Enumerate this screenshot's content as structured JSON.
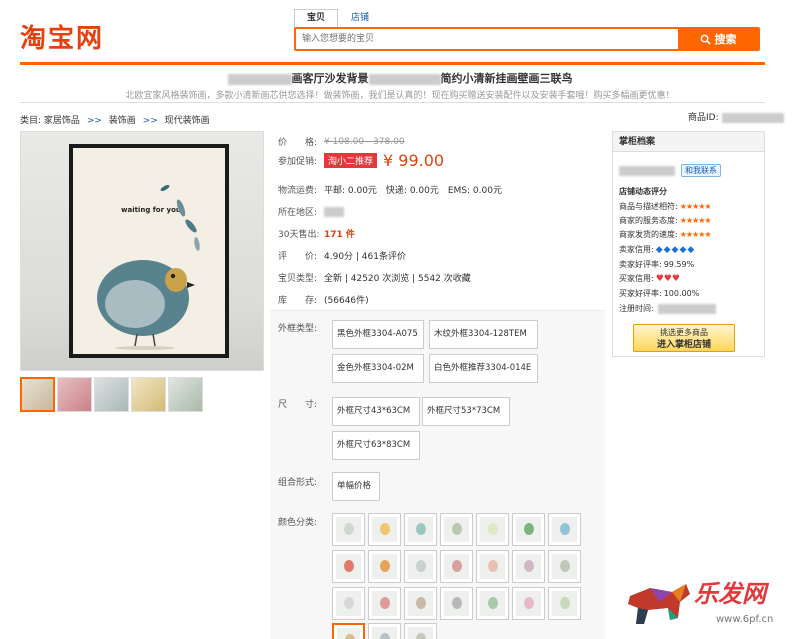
{
  "header": {
    "logo": "淘宝网",
    "tabs": [
      {
        "label": "宝贝"
      },
      {
        "label": "店铺"
      }
    ],
    "search_placeholder": "输入您想要的宝贝",
    "search_button": "搜索"
  },
  "title": {
    "part1": "画客厅沙发背景",
    "part2": "简约小清新挂画壁画三联鸟",
    "subtitle": "北欧宜家风格装饰画，多款小清新画芯供您选择！做装饰画，我们是认真的！现在购买赠送安装配件以及安装手套哦！购买多幅画更优惠！"
  },
  "breadcrumb": {
    "prefix": "类目:",
    "items": [
      "家居饰品",
      "装饰画",
      "现代装饰画"
    ],
    "separator": ">>"
  },
  "item_id_label": "商品ID:",
  "product_image": {
    "text": "waiting for you"
  },
  "info": {
    "price_label": "价　　格:",
    "price_value": "¥ 108.00 - 378.00",
    "promo_label": "参加促销:",
    "promo_badge": "淘小二推荐",
    "promo_price": "¥ 99.00",
    "shipping_label": "物流运费:",
    "shipping_value": "平邮: 0.00元　快递: 0.00元　EMS: 0.00元",
    "location_label": "所在地区:",
    "sold_label": "30天售出:",
    "sold_value": "171 件",
    "rating_label": "评　　价:",
    "rating_value": "4.90分 | 461条评价",
    "type_label": "宝贝类型:",
    "type_value": "全新 | 42520 次浏览 | 5542 次收藏",
    "stock_label": "库　　存:",
    "stock_value": "(56646件)"
  },
  "sku": {
    "frame_label": "外框类型:",
    "frame_options": [
      "黑色外框3304-A075",
      "木纹外框3304-128TEM",
      "金色外框3304-02M",
      "白色外框推荐3304-014E"
    ],
    "size_label": "尺　　寸:",
    "size_options": [
      "外框尺寸43*63CM",
      "外框尺寸53*73CM",
      "外框尺寸63*83CM"
    ],
    "combo_label": "组合形式:",
    "combo_options": [
      "单幅价格"
    ],
    "color_label": "颜色分类:"
  },
  "shop": {
    "title": "掌柜档案",
    "contact": "和我联系",
    "rating_title": "店铺动态评分",
    "rating_desc": "商品与描述相符:",
    "rating_service": "商家的服务态度:",
    "rating_speed": "商家发货的速度:",
    "seller_credit": "卖家信用:",
    "seller_rate": "卖家好评率:",
    "seller_rate_value": "99.59%",
    "buyer_credit": "买家信用:",
    "buyer_rate": "买家好评率:",
    "buyer_rate_value": "100.00%",
    "reg_time": "注册时间:",
    "enter_top": "挑选更多商品",
    "enter_bottom": "进入掌柜店铺"
  },
  "watermark": {
    "text": "乐发网",
    "url": "www.6pf.cn"
  },
  "colors": {
    "accent": "#ff6600",
    "brand": "#e4410f",
    "link": "#1a5ab6"
  }
}
